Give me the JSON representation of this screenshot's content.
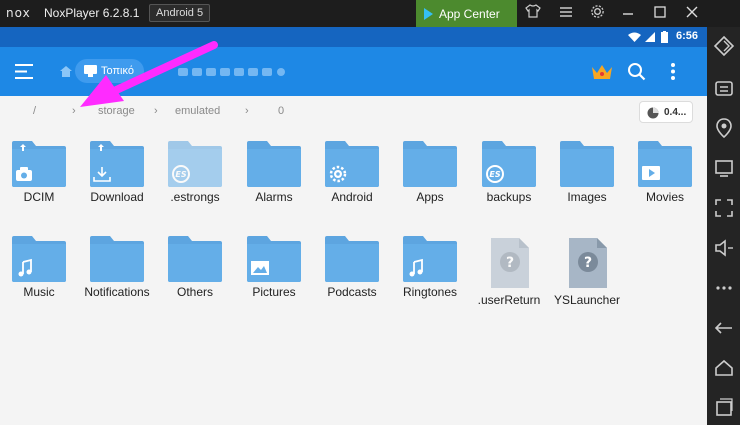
{
  "window": {
    "logo": "nox",
    "title": "NoxPlayer 6.2.8.1",
    "android_badge": "Android 5",
    "app_center": "App Center"
  },
  "status": {
    "time": "6:56"
  },
  "toolbar": {
    "location_chip": "Τοπικό"
  },
  "path": {
    "segments": [
      "/",
      "storage",
      "emulated",
      "0"
    ],
    "storage_usage": "0.4..."
  },
  "folders": [
    {
      "label": "DCIM",
      "badge": "camera",
      "faded": false
    },
    {
      "label": "Download",
      "badge": "download",
      "faded": false
    },
    {
      "label": ".estrongs",
      "badge": "es",
      "faded": true
    },
    {
      "label": "Alarms",
      "badge": "",
      "faded": false
    },
    {
      "label": "Android",
      "badge": "gear",
      "faded": false
    },
    {
      "label": "Apps",
      "badge": "",
      "faded": false
    },
    {
      "label": "backups",
      "badge": "es",
      "faded": false
    },
    {
      "label": "Images",
      "badge": "",
      "faded": false
    },
    {
      "label": "Movies",
      "badge": "play",
      "faded": false
    },
    {
      "label": "Music",
      "badge": "music",
      "faded": false
    },
    {
      "label": "Notifications",
      "badge": "",
      "faded": false
    },
    {
      "label": "Others",
      "badge": "",
      "faded": false
    },
    {
      "label": "Pictures",
      "badge": "image",
      "faded": false
    },
    {
      "label": "Podcasts",
      "badge": "",
      "faded": false
    },
    {
      "label": "Ringtones",
      "badge": "music",
      "faded": false
    },
    {
      "label": ".userReturn",
      "badge": "unknown-file",
      "faded": true
    },
    {
      "label": "YSLauncher",
      "badge": "unknown-file",
      "faded": false
    }
  ],
  "colors": {
    "toolbar": "#1e88e5",
    "statusbar": "#1565c0",
    "folder": "#64aee8",
    "folder_tab": "#5da5e0",
    "annotation": "#ff2bff",
    "app_center": "#4c8a2e"
  }
}
